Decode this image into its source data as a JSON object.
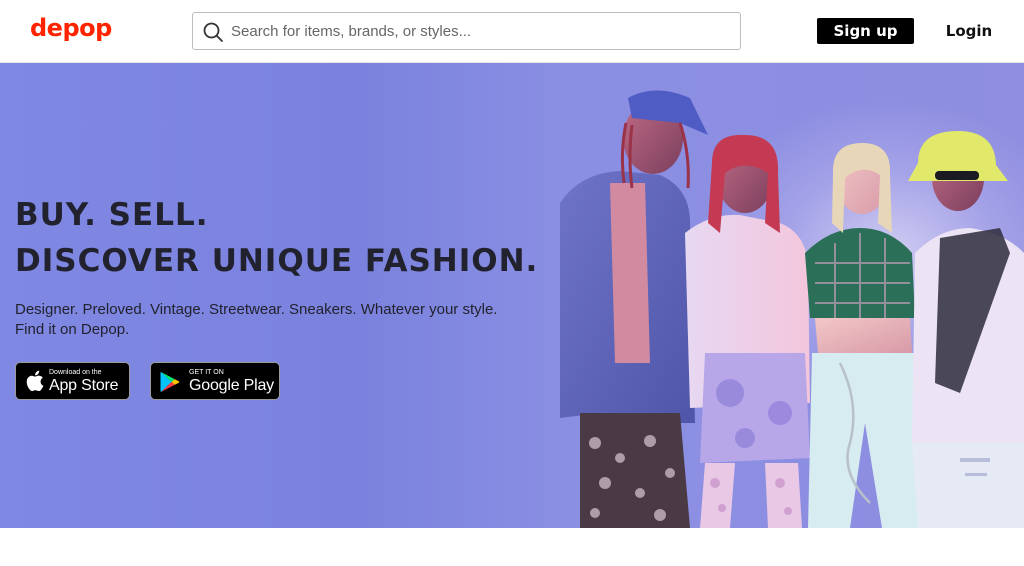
{
  "header": {
    "logo": "depop",
    "search_placeholder": "Search for items, brands, or styles...",
    "signup_label": "Sign up",
    "login_label": "Login"
  },
  "hero": {
    "headline_line1": "BUY. SELL.",
    "headline_line2": "DISCOVER UNIQUE FASHION.",
    "subtext": "Designer. Preloved. Vintage. Streetwear. Sneakers. Whatever your style. Find it on Depop.",
    "appstore": {
      "small": "Download on the",
      "big": "App Store"
    },
    "googleplay": {
      "small": "GET IT ON",
      "big": "Google Play"
    }
  },
  "colors": {
    "brand": "#ff2300",
    "hero_background": "#7f88e3",
    "text_dark": "#22222e",
    "button_black": "#000000"
  },
  "icons": [
    "search-icon",
    "apple-icon",
    "google-play-icon"
  ]
}
